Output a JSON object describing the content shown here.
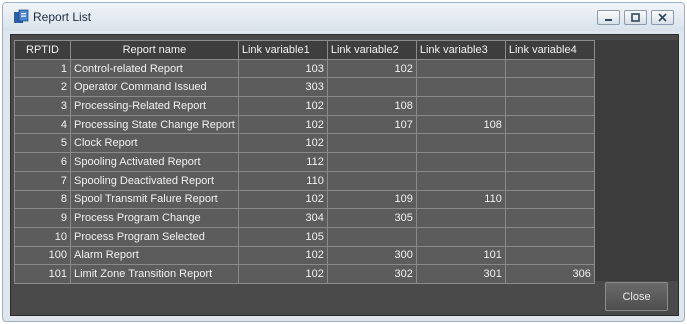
{
  "window": {
    "title": "Report List"
  },
  "table": {
    "headers": [
      "RPTID",
      "Report name",
      "Link variable1",
      "Link variable2",
      "Link variable3",
      "Link variable4"
    ],
    "rows": [
      [
        "1",
        "Control-related Report",
        "103",
        "102",
        "",
        ""
      ],
      [
        "2",
        "Operator Command Issued",
        "303",
        "",
        "",
        ""
      ],
      [
        "3",
        "Processing-Related Report",
        "102",
        "108",
        "",
        ""
      ],
      [
        "4",
        "Processing State Change Report",
        "102",
        "107",
        "108",
        ""
      ],
      [
        "5",
        "Clock Report",
        "102",
        "",
        "",
        ""
      ],
      [
        "6",
        "Spooling Activated Report",
        "112",
        "",
        "",
        ""
      ],
      [
        "7",
        "Spooling Deactivated Report",
        "110",
        "",
        "",
        ""
      ],
      [
        "8",
        "Spool Transmit Falure Report",
        "102",
        "109",
        "110",
        ""
      ],
      [
        "9",
        "Process Program Change",
        "304",
        "305",
        "",
        ""
      ],
      [
        "10",
        "Process Program Selected",
        "105",
        "",
        "",
        ""
      ],
      [
        "100",
        "Alarm Report",
        "102",
        "300",
        "101",
        ""
      ],
      [
        "101",
        "Limit Zone Transition Report",
        "102",
        "302",
        "301",
        "306"
      ]
    ]
  },
  "footer": {
    "close_label": "Close"
  },
  "colors": {
    "grid_bg": "#3c3c3c",
    "cell_bg": "#5c5c5c",
    "text": "#f2f2f2"
  }
}
